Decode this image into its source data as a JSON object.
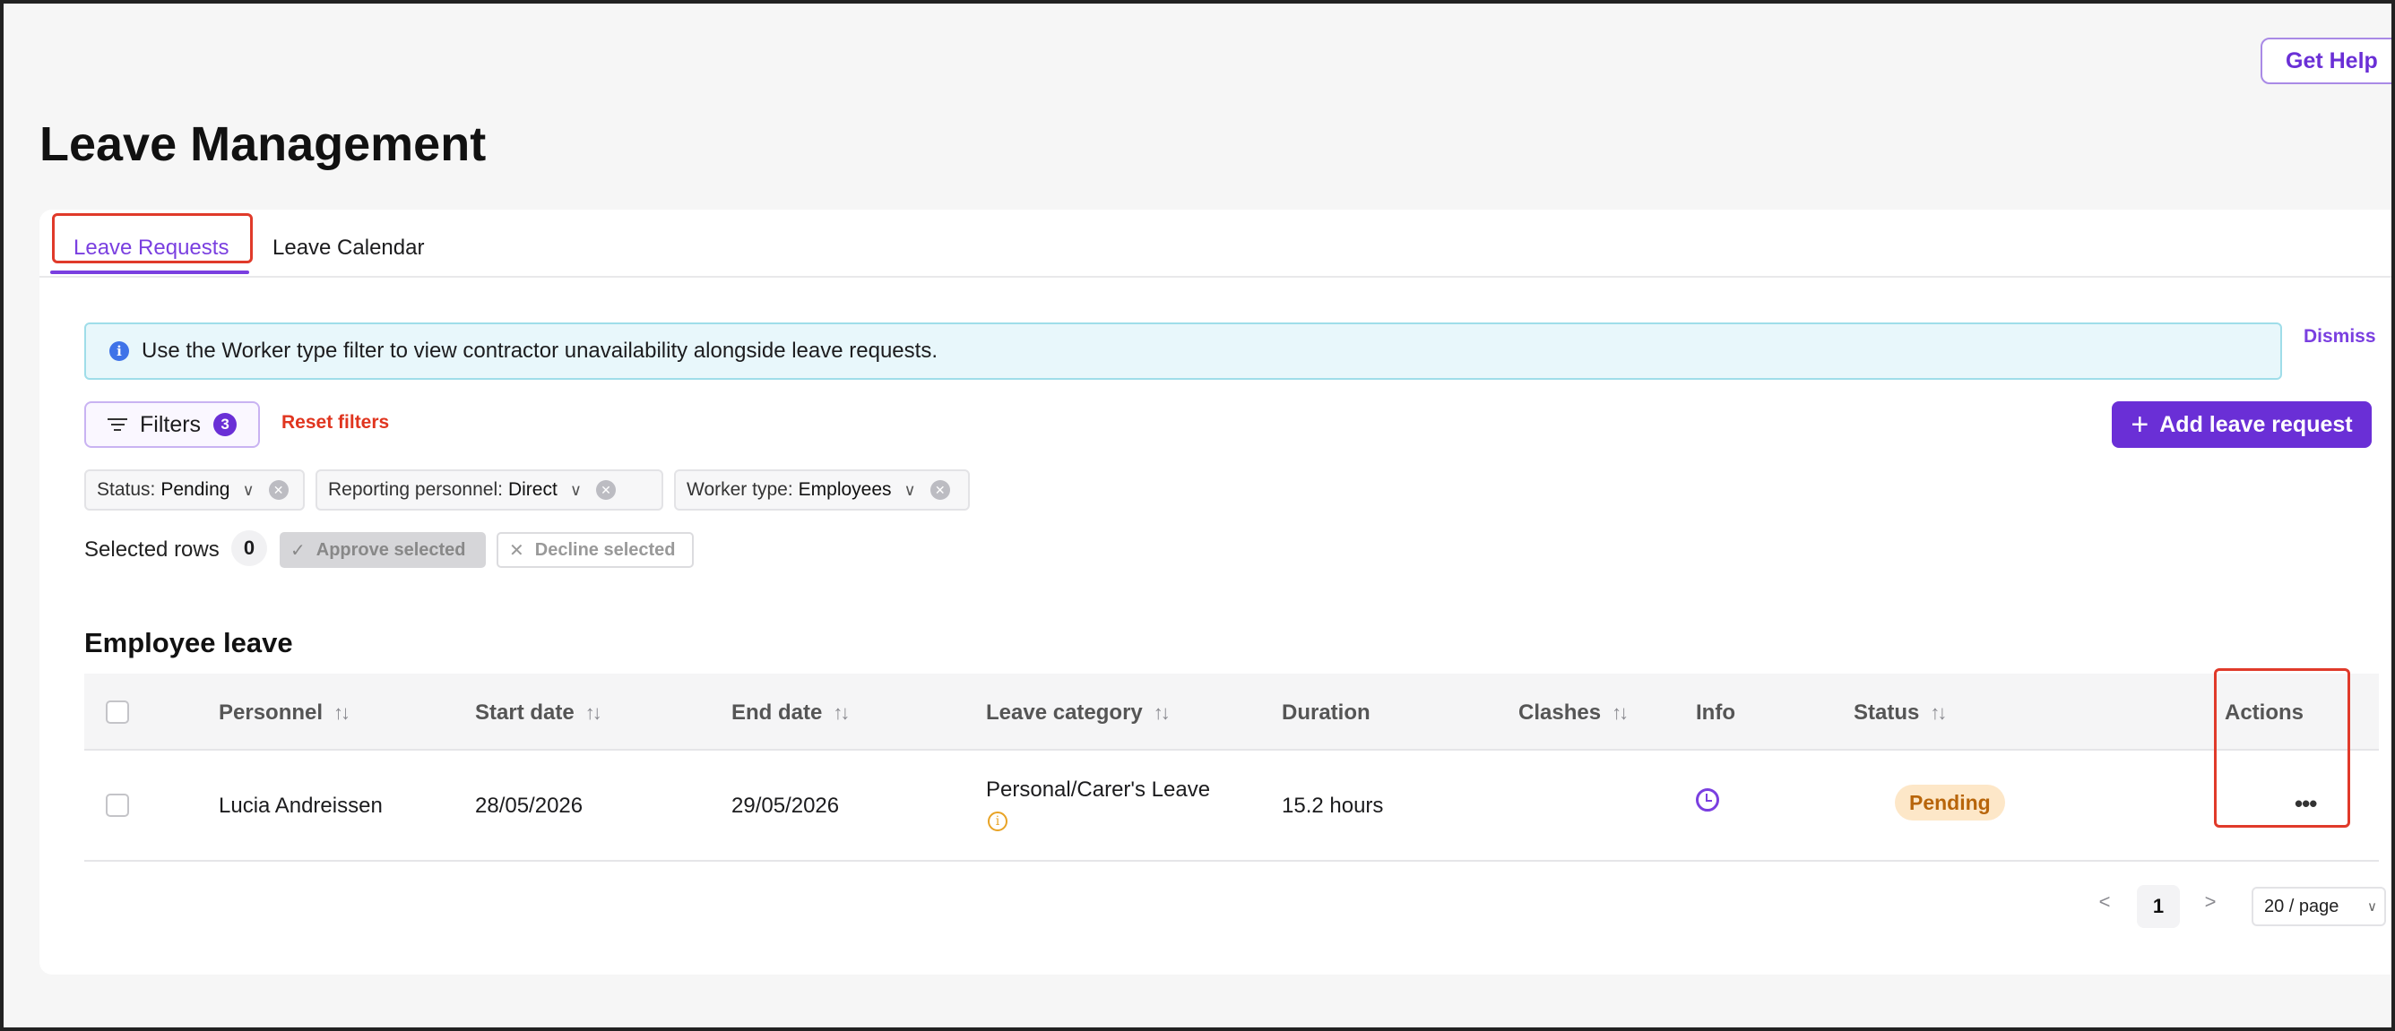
{
  "header": {
    "help_label": "Get Help"
  },
  "page": {
    "title": "Leave Management"
  },
  "tabs": [
    {
      "label": "Leave Requests",
      "active": true
    },
    {
      "label": "Leave Calendar",
      "active": false
    }
  ],
  "banner": {
    "text": "Use the Worker type filter to view contractor unavailability alongside leave requests.",
    "dismiss_label": "Dismiss",
    "icon": "info-icon"
  },
  "toolbar": {
    "filters_label": "Filters",
    "filters_count": "3",
    "reset_label": "Reset filters",
    "add_label": "Add leave request"
  },
  "filter_chips": [
    {
      "key": "Status:",
      "value": "Pending"
    },
    {
      "key": "Reporting personnel:",
      "value": "Direct"
    },
    {
      "key": "Worker type:",
      "value": "Employees"
    }
  ],
  "selection": {
    "label": "Selected rows",
    "count": "0",
    "approve_label": "Approve selected",
    "decline_label": "Decline selected"
  },
  "section": {
    "title": "Employee leave"
  },
  "table": {
    "columns": [
      "Personnel",
      "Start date",
      "End date",
      "Leave category",
      "Duration",
      "Clashes",
      "Info",
      "Status",
      "Actions"
    ],
    "rows": [
      {
        "personnel": "Lucia Andreissen",
        "start_date": "28/05/2026",
        "end_date": "29/05/2026",
        "leave_category": "Personal/Carer's Leave",
        "duration": "15.2 hours",
        "status": "Pending"
      }
    ]
  },
  "pagination": {
    "prev": "<",
    "current_page": "1",
    "next": ">",
    "page_size": "20 / page"
  },
  "colors": {
    "accent": "#6a2fd6",
    "highlight": "#e03a2a",
    "pending_bg": "#fde7c8",
    "pending_text": "#b8650a"
  }
}
